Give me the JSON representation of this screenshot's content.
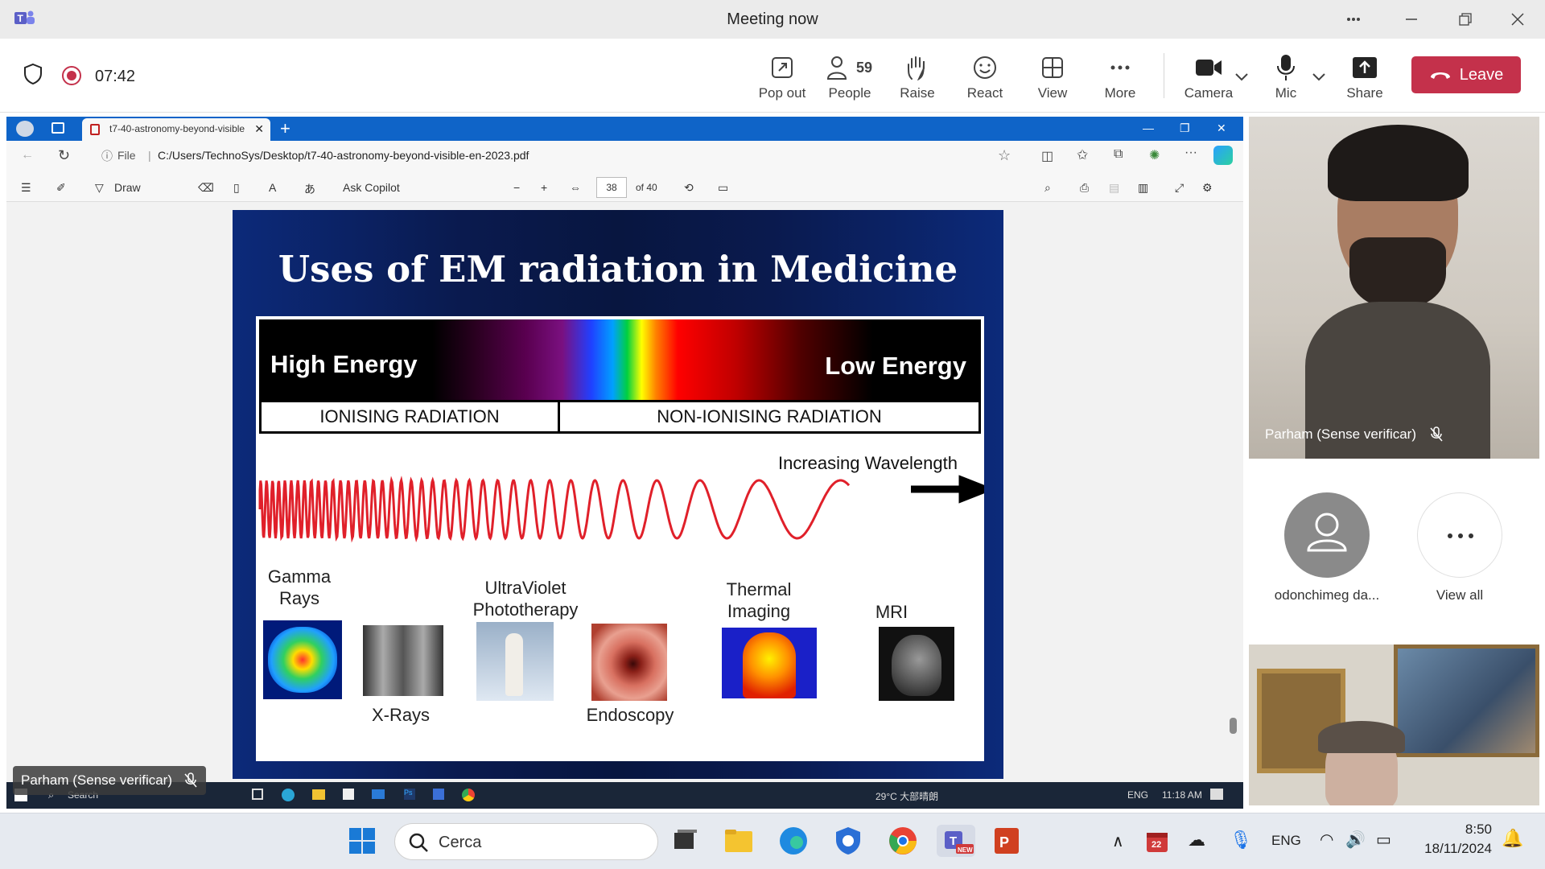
{
  "window": {
    "title": "Meeting now"
  },
  "toolbar": {
    "timer": "07:42",
    "pop_out": "Pop out",
    "people_count": "59",
    "people": "People",
    "raise": "Raise",
    "react": "React",
    "view": "View",
    "more": "More",
    "camera": "Camera",
    "mic": "Mic",
    "share": "Share",
    "leave": "Leave"
  },
  "browser": {
    "tab_title": "t7-40-astronomy-beyond-visible",
    "file_label": "File",
    "address": "C:/Users/TechnoSys/Desktop/t7-40-astronomy-beyond-visible-en-2023.pdf",
    "draw": "Draw",
    "ask_copilot": "Ask Copilot",
    "page_current": "38",
    "page_total": "of 40"
  },
  "slide": {
    "title": "Uses of EM radiation in Medicine",
    "high_energy": "High Energy",
    "low_energy": "Low Energy",
    "ionising": "IONISING RADIATION",
    "non_ionising": "NON-IONISING RADIATION",
    "wavelength": "Increasing Wavelength",
    "gamma_1": "Gamma",
    "gamma_2": "Rays",
    "xrays": "X-Rays",
    "uv_1": "UltraViolet",
    "uv_2": "Phototherapy",
    "endoscopy": "Endoscopy",
    "thermal_1": "Thermal",
    "thermal_2": "Imaging",
    "mri": "MRI"
  },
  "shared_taskbar": {
    "search": "Search",
    "weather": "29°C 大部晴朗",
    "lang": "ENG",
    "time": "11:18 AM"
  },
  "sharer_name": "Parham (Sense verificar)",
  "participants": {
    "video1_name": "Parham (Sense verificar)",
    "avatar_name": "odonchimeg da...",
    "view_all": "View all"
  },
  "taskbar": {
    "search": "Cerca",
    "lang": "ENG",
    "time": "8:50",
    "date": "18/11/2024",
    "calendar_badge": "22"
  },
  "colors": {
    "leave": "#c4314b",
    "teams_purple": "#5b5fc7",
    "edge_blue": "#0f64c8",
    "wave": "#e0202a"
  }
}
